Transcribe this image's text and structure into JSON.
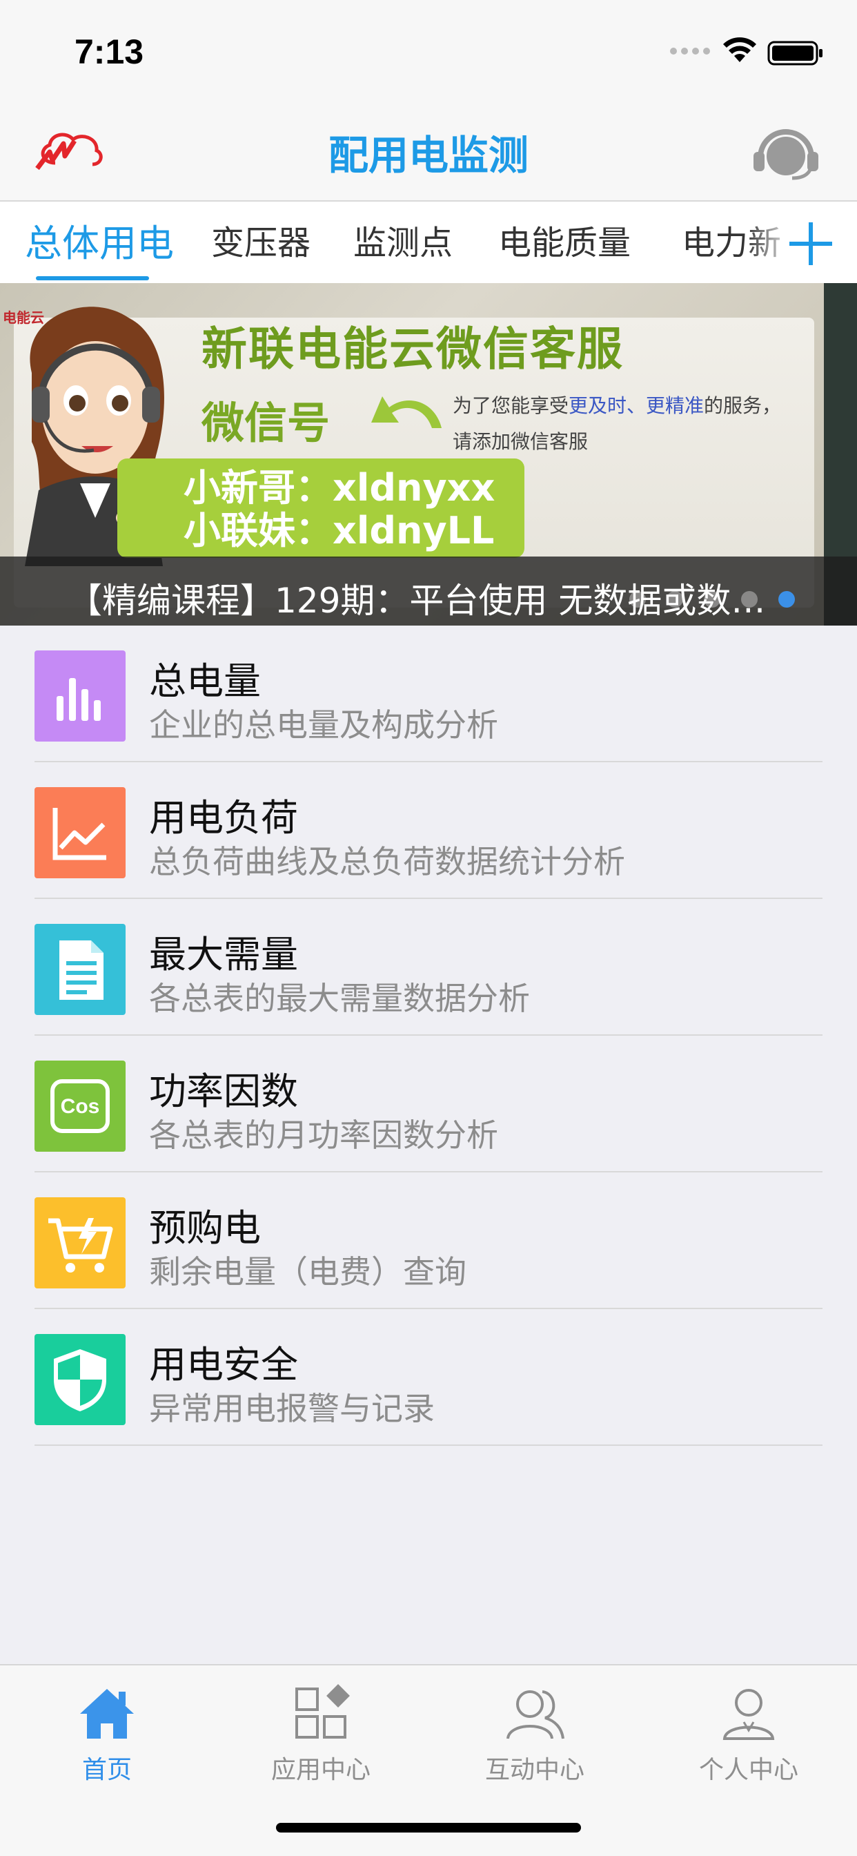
{
  "status": {
    "time": "7:13"
  },
  "header": {
    "title": "配用电监测"
  },
  "tabs": [
    {
      "label": "总体用电",
      "active": true
    },
    {
      "label": "变压器"
    },
    {
      "label": "监测点"
    },
    {
      "label": "电能质量"
    },
    {
      "label": "电力新"
    }
  ],
  "banner": {
    "mini_brand": "电能云",
    "headline": "新联电能云微信客服",
    "wechat_label": "微信号",
    "note_prefix": "为了您能享受",
    "note_highlight": "更及时、更精准",
    "note_suffix": "的服务，",
    "note_line2": "请添加微信客服",
    "id_1": "小新哥：xldnyxx",
    "id_2": "小联妹：xldnyLL",
    "caption": "【精编课程】129期：平台使用 无数据或数…",
    "dots": 5,
    "active_dot": 4
  },
  "menu": [
    {
      "title": "总电量",
      "subtitle": "企业的总电量及构成分析",
      "icon": "bar-chart-icon",
      "color": "#c58af5"
    },
    {
      "title": "用电负荷",
      "subtitle": "总负荷曲线及总负荷数据统计分析",
      "icon": "line-chart-icon",
      "color": "#fb7d56"
    },
    {
      "title": "最大需量",
      "subtitle": "各总表的最大需量数据分析",
      "icon": "document-icon",
      "color": "#35c0d8"
    },
    {
      "title": "功率因数",
      "subtitle": "各总表的月功率因数分析",
      "icon": "cos-icon",
      "color": "#7ec33c",
      "icon_text": "Cos"
    },
    {
      "title": "预购电",
      "subtitle": "剩余电量（电费）查询",
      "icon": "cart-lightning-icon",
      "color": "#fcbf2c"
    },
    {
      "title": "用电安全",
      "subtitle": "异常用电报警与记录",
      "icon": "shield-icon",
      "color": "#19ce9c"
    }
  ],
  "tabbar": [
    {
      "label": "首页",
      "icon": "home-icon",
      "active": true
    },
    {
      "label": "应用中心",
      "icon": "apps-icon"
    },
    {
      "label": "互动中心",
      "icon": "people-icon"
    },
    {
      "label": "个人中心",
      "icon": "person-icon"
    }
  ],
  "colors": {
    "accent": "#1d9ae6",
    "tab_active": "#2f8ee9",
    "brand_red": "#e3262b"
  }
}
